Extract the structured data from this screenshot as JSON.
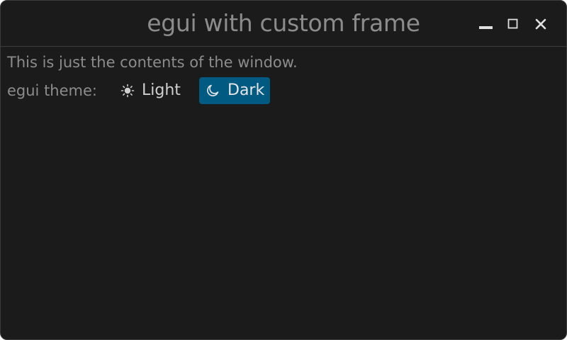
{
  "window": {
    "title": "egui with custom frame",
    "controls": {
      "minimize_icon": "minimize-icon",
      "maximize_icon": "maximize-icon",
      "close_icon": "close-icon"
    }
  },
  "content": {
    "description": "This is just the contents of the window.",
    "theme": {
      "label": "egui theme:",
      "options": [
        {
          "icon": "sun-icon",
          "label": "Light",
          "selected": false
        },
        {
          "icon": "moon-icon",
          "label": "Dark",
          "selected": true
        }
      ]
    }
  },
  "colors": {
    "window_background": "#1b1b1b",
    "text": "#8c8c8c",
    "selected_background": "#005a82"
  }
}
